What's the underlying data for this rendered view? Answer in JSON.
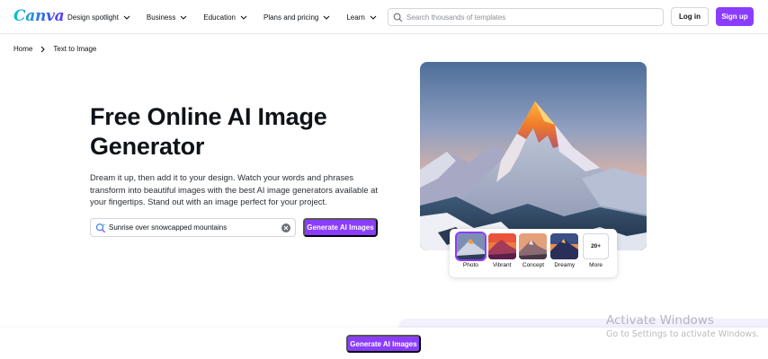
{
  "header": {
    "logo": "Canva",
    "nav": [
      {
        "label": "Design spotlight"
      },
      {
        "label": "Business"
      },
      {
        "label": "Education"
      },
      {
        "label": "Plans and pricing"
      },
      {
        "label": "Learn"
      }
    ],
    "search_placeholder": "Search thousands of templates",
    "login_label": "Log in",
    "signup_label": "Sign up"
  },
  "breadcrumb": {
    "home": "Home",
    "current": "Text to Image"
  },
  "hero": {
    "title": "Free Online AI Image Generator",
    "description": "Dream it up, then add it to your design. Watch your words and phrases transform into beautiful images with the best AI image generators available at your fingertips. Stand out with an image perfect for your project.",
    "prompt_value": "Sunrise over snowcapped mountains",
    "generate_label": "Generate AI Images"
  },
  "styles": {
    "options": [
      {
        "label": "Photo",
        "selected": true
      },
      {
        "label": "Vibrant",
        "selected": false
      },
      {
        "label": "Concept",
        "selected": false
      },
      {
        "label": "Dreamy",
        "selected": false
      }
    ],
    "more_count": "20+",
    "more_label": "More"
  },
  "bottom": {
    "generate_label": "Generate AI Images"
  },
  "watermark": {
    "line1": "Activate Windows",
    "line2": "Go to Settings to activate Windows."
  },
  "colors": {
    "brand_purple": "#8b3dff",
    "logo_gradient_start": "#00c4cc",
    "logo_gradient_end": "#5a32fa"
  }
}
